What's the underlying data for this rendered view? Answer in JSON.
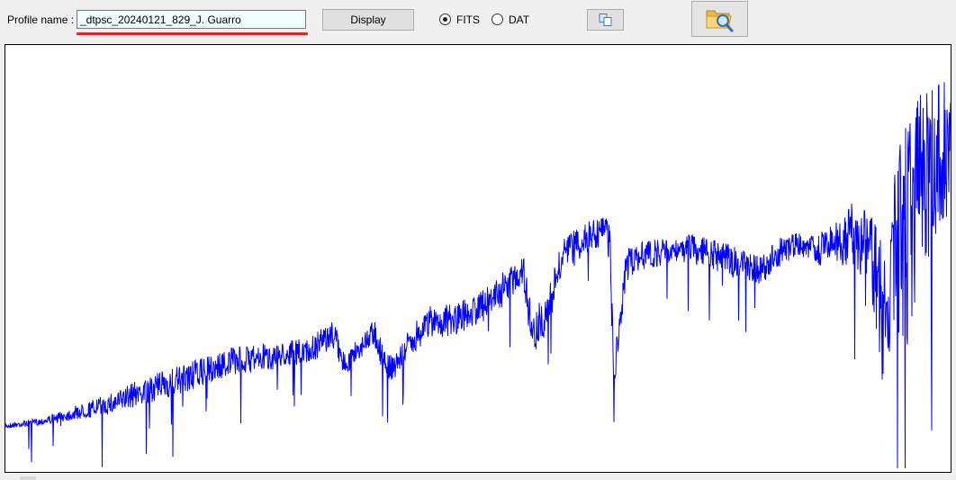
{
  "toolbar": {
    "profile_label": "Profile name :",
    "profile_value": "_dtpsc_20240121_829_J. Guarro",
    "display_label": "Display",
    "format_options": [
      {
        "label": "FITS",
        "selected": true
      },
      {
        "label": "DAT",
        "selected": false
      }
    ]
  },
  "icons": {
    "copy": "copy-icon",
    "folder_search": "folder-search-icon"
  },
  "colors": {
    "spectrum_line": "#0000ff",
    "plot_background": "#ffffff",
    "profile_underline": "#e0242a",
    "input_background": "#f0fffe"
  }
}
